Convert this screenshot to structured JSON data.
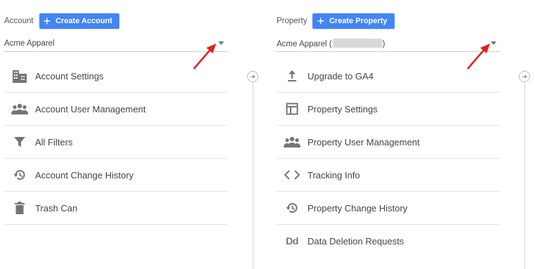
{
  "account": {
    "label": "Account",
    "create_button": "Create Account",
    "selector_value": "Acme Apparel",
    "menu": [
      {
        "icon": "building-icon",
        "label": "Account Settings"
      },
      {
        "icon": "people-icon",
        "label": "Account User Management"
      },
      {
        "icon": "filter-icon",
        "label": "All Filters"
      },
      {
        "icon": "history-icon",
        "label": "Account Change History"
      },
      {
        "icon": "trash-icon",
        "label": "Trash Can"
      }
    ]
  },
  "property": {
    "label": "Property",
    "create_button": "Create Property",
    "selector_prefix": "Acme Apparel (",
    "selector_suffix": ")",
    "menu": [
      {
        "icon": "upload-icon",
        "label": "Upgrade to GA4"
      },
      {
        "icon": "layout-icon",
        "label": "Property Settings"
      },
      {
        "icon": "people-icon",
        "label": "Property User Management"
      },
      {
        "icon": "code-icon",
        "label": "Tracking Info"
      },
      {
        "icon": "history-icon",
        "label": "Property Change History"
      },
      {
        "icon": "data-deletion-icon",
        "label": "Data Deletion Requests",
        "icon_text": "Dd"
      }
    ]
  },
  "colors": {
    "button_bg": "#4285f4",
    "annotation_arrow": "#e02020",
    "icon": "#757575"
  }
}
